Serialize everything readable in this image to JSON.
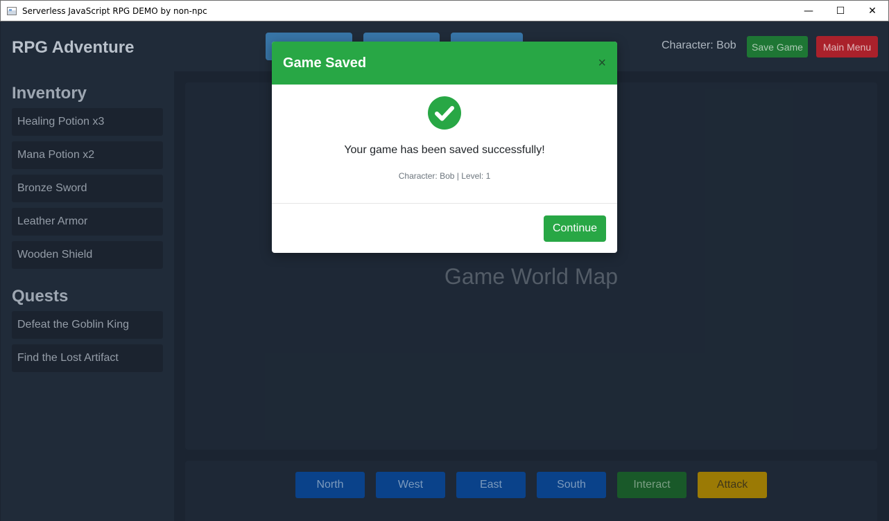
{
  "window": {
    "title": "Serverless JavaScript RPG DEMO by non-npc",
    "minimize": "—",
    "maximize": "☐",
    "close": "✕"
  },
  "header": {
    "brand": "RPG Adventure",
    "character_label": "Character: Bob",
    "save_label": "Save Game",
    "menu_label": "Main Menu"
  },
  "sidebar": {
    "inventory_title": "Inventory",
    "inventory": [
      "Healing Potion x3",
      "Mana Potion x2",
      "Bronze Sword",
      "Leather Armor",
      "Wooden Shield"
    ],
    "quests_title": "Quests",
    "quests": [
      "Defeat the Goblin King",
      "Find the Lost Artifact"
    ]
  },
  "map": {
    "label": "Game World Map"
  },
  "controls": {
    "north": "North",
    "west": "West",
    "east": "East",
    "south": "South",
    "interact": "Interact",
    "attack": "Attack"
  },
  "modal": {
    "title": "Game Saved",
    "close": "×",
    "message": "Your game has been saved successfully!",
    "details": "Character: Bob | Level: 1",
    "continue_label": "Continue"
  },
  "colors": {
    "success": "#28a745",
    "danger": "#b0232d",
    "primary_dim": "#0b458f",
    "warning_dim": "#a07e06"
  }
}
